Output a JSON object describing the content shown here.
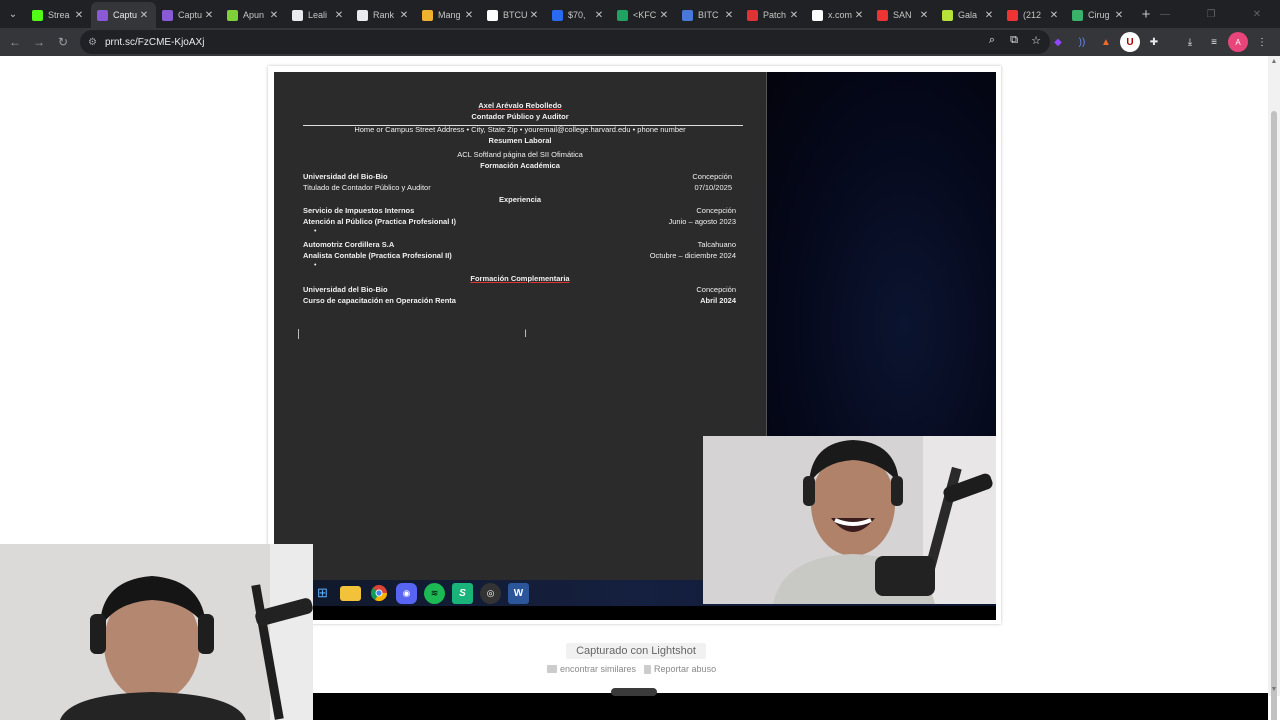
{
  "tabs": [
    {
      "label": "Strea",
      "icon": "kick-icon",
      "color": "#53fc18",
      "active": false
    },
    {
      "label": "Captu",
      "icon": "lightshot-icon",
      "color": "#8a5ad6",
      "active": true
    },
    {
      "label": "Captu",
      "icon": "lightshot-icon",
      "color": "#8a5ad6",
      "active": false
    },
    {
      "label": "Apun",
      "icon": "apuntes-icon",
      "color": "#7fd13b",
      "active": false
    },
    {
      "label": "Leali",
      "icon": "diamond-icon",
      "color": "#e8eaed",
      "active": false
    },
    {
      "label": "Rank",
      "icon": "diamond-icon",
      "color": "#e8eaed",
      "active": false
    },
    {
      "label": "Mang",
      "icon": "manga-icon",
      "color": "#f0b030",
      "active": false
    },
    {
      "label": "BTCU",
      "icon": "tradingview-icon",
      "color": "#ffffff",
      "active": false
    },
    {
      "label": "$70,",
      "icon": "x-icon",
      "color": "#2a6af0",
      "active": false
    },
    {
      "label": "<KFC",
      "icon": "sheets-icon",
      "color": "#1ea362",
      "active": false
    },
    {
      "label": "BITC",
      "icon": "bitso-icon",
      "color": "#4a78d8",
      "active": false
    },
    {
      "label": "Patch",
      "icon": "patch-icon",
      "color": "#d33",
      "active": false
    },
    {
      "label": "x.com",
      "icon": "x-icon",
      "color": "#ffffff",
      "active": false
    },
    {
      "label": "SAN",
      "icon": "san-icon",
      "color": "#e33",
      "active": false
    },
    {
      "label": "Gala",
      "icon": "gala-icon",
      "color": "#b7e23a",
      "active": false
    },
    {
      "label": "(212",
      "icon": "youtube-icon",
      "color": "#e33",
      "active": false
    },
    {
      "label": "Cirug",
      "icon": "cirugia-icon",
      "color": "#3ab36a",
      "active": false
    }
  ],
  "toolbar": {
    "url": "prnt.sc/FzCME-KjoAXj"
  },
  "resume": {
    "name": "Axel Arévalo Rebolledo",
    "role": "Contador Público y Auditor",
    "contact": "Home or Campus Street Address • City, State Zip • youremail@college.harvard.edu • phone number",
    "summary_heading": "Resumen Laboral",
    "summary_text": "ACL Softland página del SII Ofimática",
    "education_heading": "Formación Académica",
    "edu_school": "Universidad del Bio-Bio",
    "edu_city": "Concepción",
    "edu_degree": "Titulado de Contador Público y Auditor",
    "edu_date": "07/10/2025",
    "experience_heading": "Experiencia",
    "exp1_org": "Servicio de Impuestos Internos",
    "exp1_city": "Concepción",
    "exp1_role": "Atención al Público (Practica Profesional I)",
    "exp1_date": "Junio – agosto 2023",
    "exp2_org": "Automotriz Cordillera S.A",
    "exp2_city": "Talcahuano",
    "exp2_role": "Analista Contable (Practica Profesional II)",
    "exp2_date": "Octubre – diciembre 2024",
    "comp_heading": "Formación Complementaria",
    "comp_school": "Universidad del Bio-Bio",
    "comp_city": "Concepción",
    "comp_course": "Curso de capacitación en Operación Renta",
    "comp_date": "Abril 2024",
    "bullet": "•"
  },
  "taskbar": {
    "word_label": "W"
  },
  "lightshot": {
    "caption": "Capturado con Lightshot",
    "find_similar": "encontrar similares",
    "report": "Reportar abuso"
  }
}
